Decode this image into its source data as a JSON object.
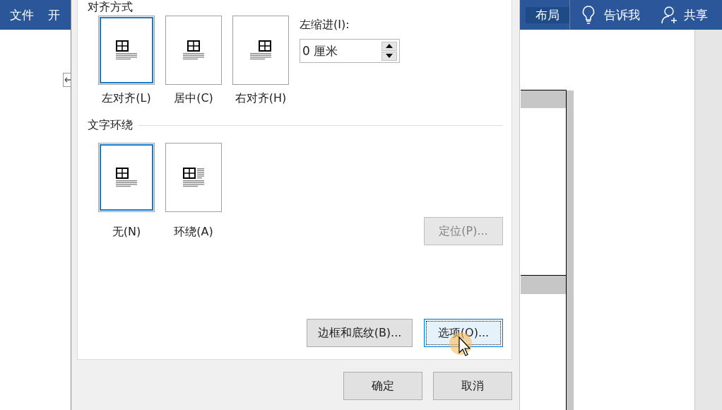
{
  "ribbon": {
    "tabs": [
      {
        "label": "文件",
        "selected": false
      },
      {
        "label": "开",
        "selected": false
      },
      {
        "label": "布局",
        "selected": true
      }
    ],
    "tell_me": "告诉我",
    "share": "共享"
  },
  "dialog": {
    "alignment": {
      "title": "对齐方式",
      "options": [
        {
          "label": "左对齐(L)",
          "kind": "left",
          "selected": true
        },
        {
          "label": "居中(C)",
          "kind": "center",
          "selected": false
        },
        {
          "label": "右对齐(H)",
          "kind": "right",
          "selected": false
        }
      ]
    },
    "left_indent": {
      "label": "左缩进(I):",
      "value": "0 厘米"
    },
    "wrapping": {
      "title": "文字环绕",
      "options": [
        {
          "label": "无(N)",
          "kind": "none",
          "selected": true
        },
        {
          "label": "环绕(A)",
          "kind": "around",
          "selected": false
        }
      ]
    },
    "position_button": {
      "label": "定位(P)...",
      "disabled": true
    },
    "borders_button": {
      "label": "边框和底纹(B)...",
      "focused": false
    },
    "options_button": {
      "label": "选项(O)...",
      "focused": true
    },
    "ok": "确定",
    "cancel": "取消"
  }
}
